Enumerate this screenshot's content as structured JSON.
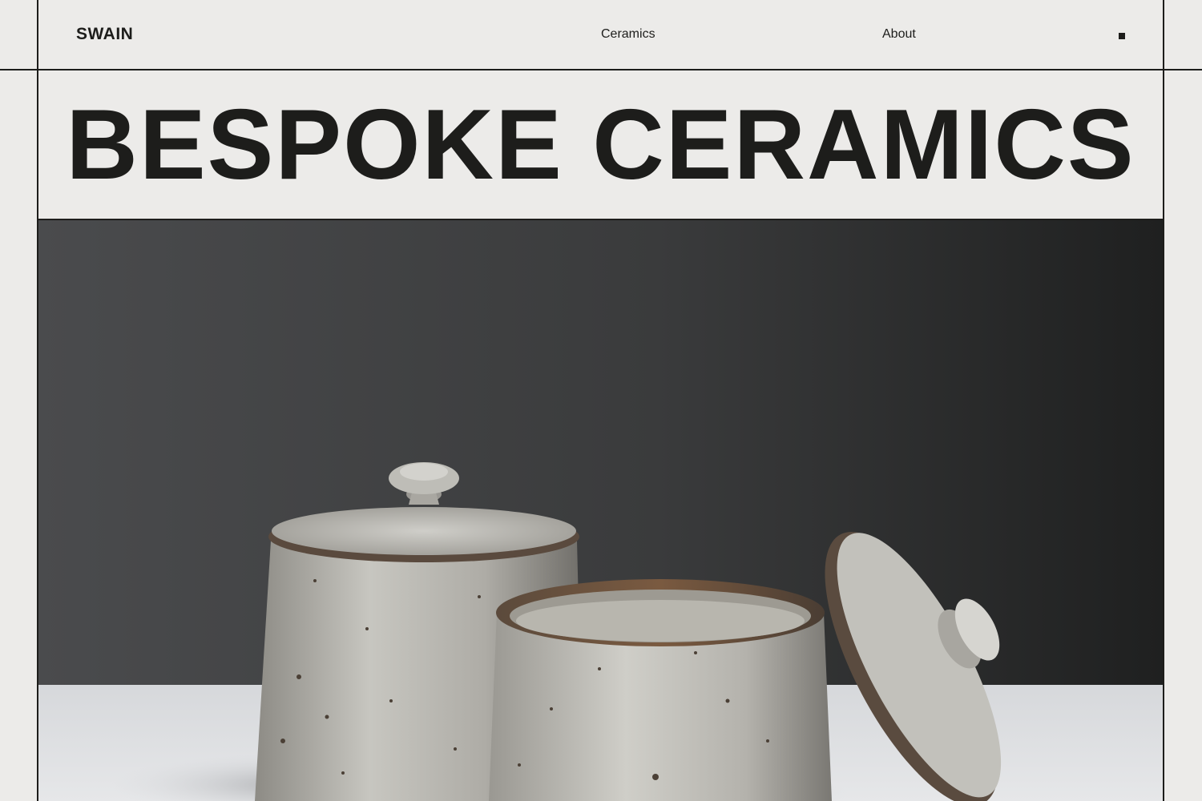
{
  "header": {
    "brand": "SWAIN",
    "nav": [
      {
        "label": "Ceramics"
      },
      {
        "label": "About"
      }
    ],
    "menu_icon": "square-menu-icon"
  },
  "hero": {
    "title": "BESPOKE CERAMICS"
  },
  "colors": {
    "background": "#ecebe9",
    "ink": "#1d1d1b",
    "photo_wall": "#3e3f40",
    "photo_table": "#dfe1e3",
    "glaze": "#b9b8b2"
  }
}
